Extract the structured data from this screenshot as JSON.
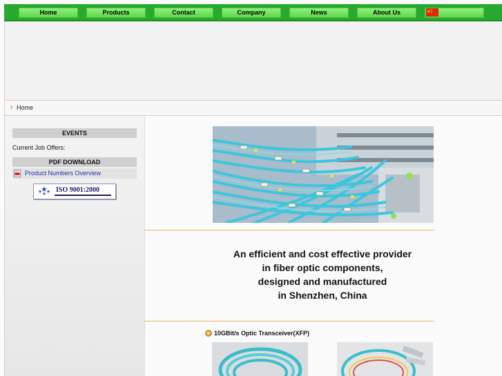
{
  "nav": {
    "items": [
      {
        "label": "Home"
      },
      {
        "label": "Products"
      },
      {
        "label": "Contact"
      },
      {
        "label": "Company"
      },
      {
        "label": "News"
      },
      {
        "label": "About Us"
      },
      {
        "label": ""
      }
    ],
    "flag_icon": "china-flag-icon"
  },
  "breadcrumb": {
    "home": "Home"
  },
  "sidebar": {
    "events_header": "EVENTS",
    "job_offers": "Current Job Offers:",
    "pdf_header": "PDF DOWNLOAD",
    "pdf_link": "Product Numbers Overview",
    "iso_badge": "ISO 9001:2000"
  },
  "main": {
    "tagline": [
      "An efficient and cost effective provider",
      "in fiber optic components,",
      "designed and manufactured",
      "in Shenzhen, China"
    ],
    "product_label": "10GBit/s Optic Transceiver(XFP)"
  },
  "colors": {
    "nav_bg": "#26a92e",
    "nav_button": "#7ee86b",
    "divider": "#f0b36a",
    "link": "#2233aa"
  }
}
